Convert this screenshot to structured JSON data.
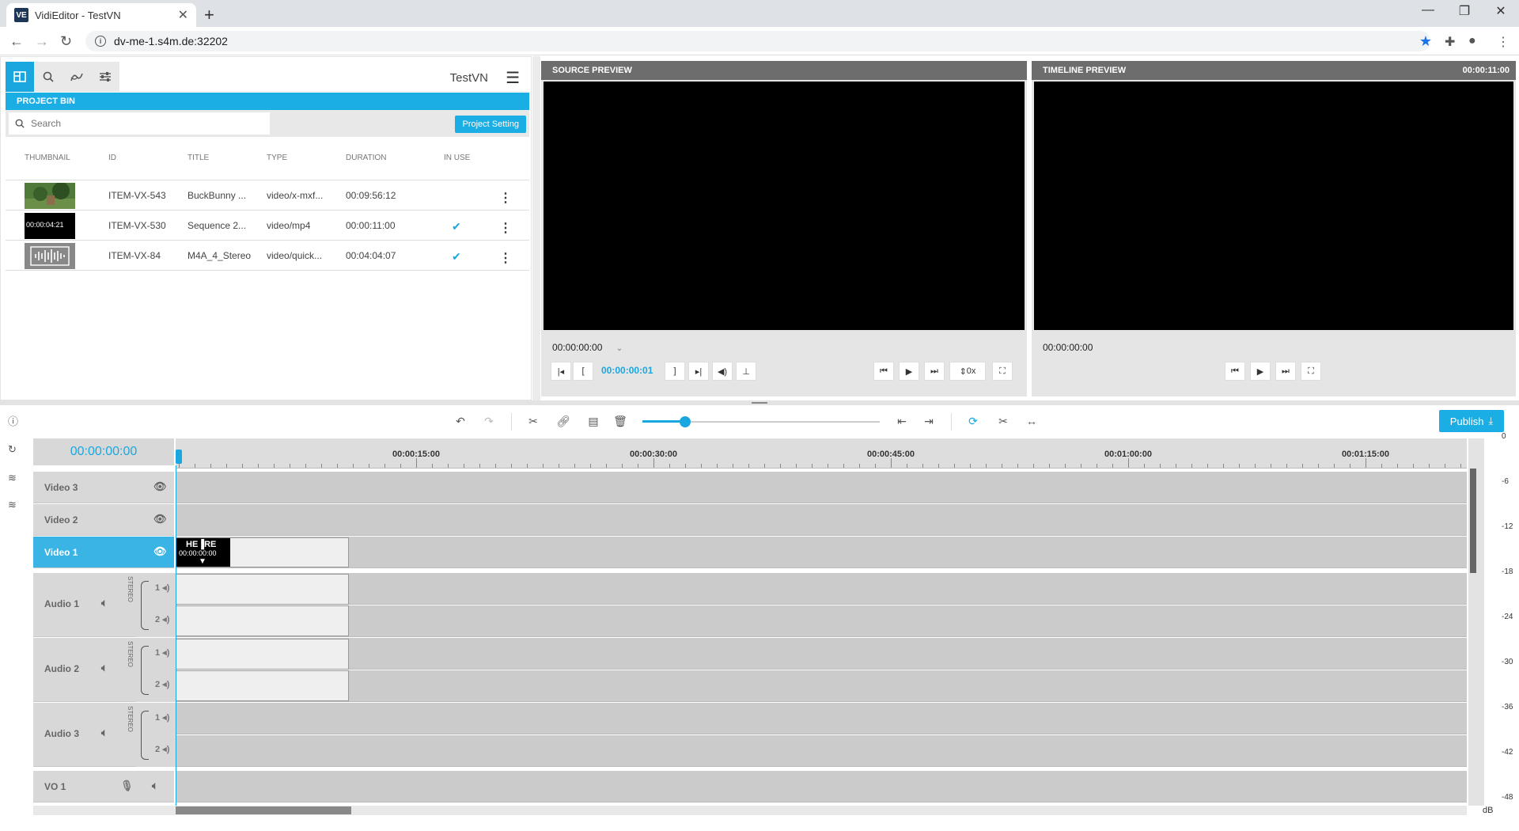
{
  "browser": {
    "tab_title": "VidiEditor - TestVN",
    "favicon": "VE",
    "url": "dv-me-1.s4m.de:32202",
    "new_tab": "+"
  },
  "project": {
    "name": "TestVN",
    "bin_title": "PROJECT BIN",
    "search_placeholder": "Search",
    "settings_button": "Project Setting",
    "columns": [
      "THUMBNAIL",
      "ID",
      "TITLE",
      "TYPE",
      "DURATION",
      "IN USE"
    ],
    "items": [
      {
        "id": "ITEM-VX-543",
        "title": "BuckBunny ...",
        "type": "video/x-mxf...",
        "duration": "00:09:56:12",
        "in_use": false
      },
      {
        "id": "ITEM-VX-530",
        "title": "Sequence 2...",
        "type": "video/mp4",
        "duration": "00:00:11:00",
        "in_use": true,
        "thumb_tc": "00:00:04:21"
      },
      {
        "id": "ITEM-VX-84",
        "title": "M4A_4_Stereo",
        "type": "video/quick...",
        "duration": "00:04:04:07",
        "in_use": true
      }
    ]
  },
  "source_preview": {
    "title": "SOURCE PREVIEW",
    "timecode": "00:00:00:00",
    "duration_tc": "00:00:00:01",
    "speed": "0x"
  },
  "timeline_preview": {
    "title": "TIMELINE PREVIEW",
    "header_tc": "00:00:11:00",
    "timecode": "00:00:00:00"
  },
  "timeline": {
    "publish_label": "Publish",
    "current_tc": "00:00:00:00",
    "zoom_level": 0.18,
    "ruler_labels": [
      "00:00:15:00",
      "00:00:30:00",
      "00:00:45:00",
      "00:01:00:00",
      "00:01:15:00"
    ],
    "tracks": {
      "video3": "Video 3",
      "video2": "Video 2",
      "video1": "Video 1",
      "audio1": "Audio 1",
      "audio2": "Audio 2",
      "audio3": "Audio 3",
      "vo1": "VO 1"
    },
    "stereo_label": "STEREO",
    "channels": [
      "1",
      "2"
    ],
    "clip_thumb_text": "HE▐RE",
    "clip_thumb_tc": "00:00:00:00",
    "db_scale": [
      "0",
      "-6",
      "-12",
      "-18",
      "-24",
      "-30",
      "-36",
      "-42",
      "-48"
    ],
    "db_unit": "dB"
  },
  "colors": {
    "accent": "#1aaee5",
    "panel_header": "#6d6d6d",
    "track_bg": "#cbcbcb"
  }
}
